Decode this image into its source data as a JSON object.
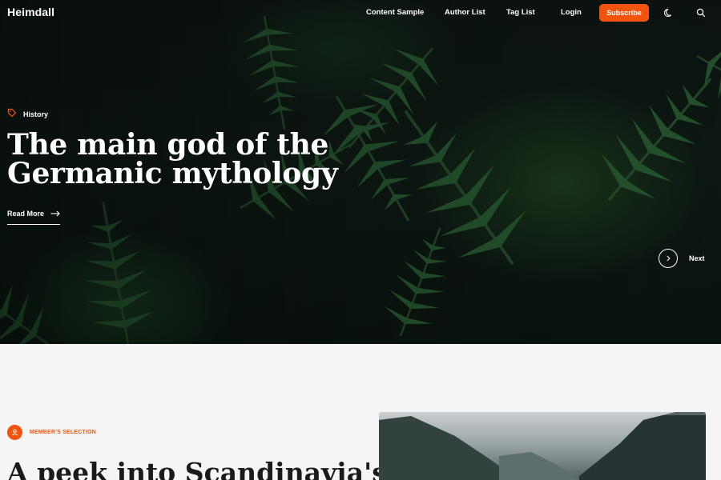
{
  "brand": "Heimdall",
  "nav": {
    "links": [
      "Content Sample",
      "Author List",
      "Tag List",
      "Login"
    ],
    "subscribe_label": "Subscribe",
    "theme_icon": "moon-icon",
    "search_icon": "search-icon"
  },
  "hero": {
    "tag": "History",
    "tag_icon": "tag-icon",
    "title": "The main god of the Germanic mythology",
    "read_more": "Read More",
    "next_label": "Next"
  },
  "featured": {
    "badge": "MEMBER'S SELECTION",
    "badge_icon": "user-icon",
    "title": "A peek into Scandinavia's"
  },
  "colors": {
    "accent": "#f2540e",
    "hero_bg": "#0f1a14",
    "section_bg": "#f5f5f5"
  }
}
